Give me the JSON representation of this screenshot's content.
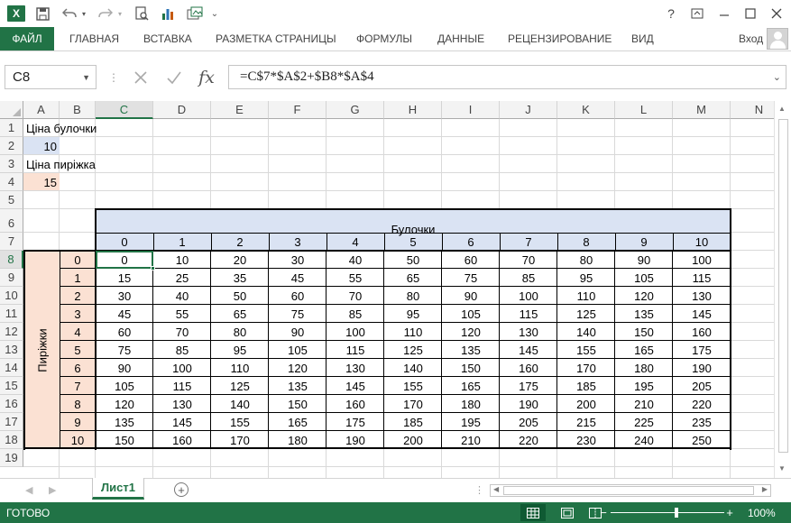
{
  "window": {
    "help_label": "?",
    "quick_access_more": "⌄"
  },
  "ribbon": {
    "file": "ФАЙЛ",
    "tabs": [
      "ГЛАВНАЯ",
      "ВСТАВКА",
      "РАЗМЕТКА СТРАНИЦЫ",
      "ФОРМУЛЫ",
      "ДАННЫЕ",
      "РЕЦЕНЗИРОВАНИЕ",
      "ВИД"
    ],
    "login": "Вход"
  },
  "formula_bar": {
    "name_box": "C8",
    "fx_label": "fx",
    "formula": "=C$7*$A$2+$B8*$A$4"
  },
  "grid": {
    "columns": [
      "A",
      "B",
      "C",
      "D",
      "E",
      "F",
      "G",
      "H",
      "I",
      "J",
      "K",
      "L",
      "M",
      "N"
    ],
    "selected_column": "C",
    "rows": [
      "1",
      "2",
      "3",
      "4",
      "5",
      "6",
      "7",
      "8",
      "9",
      "10",
      "11",
      "12",
      "13",
      "14",
      "15",
      "16",
      "17",
      "18",
      "19"
    ],
    "selected_row": "8"
  },
  "cells": {
    "A1": "Ціна булочки",
    "A2": "10",
    "A3": "Ціна пиріжка",
    "A4": "15",
    "header_top": "Булочки",
    "header_side": "Пиріжки",
    "col_values": [
      "0",
      "1",
      "2",
      "3",
      "4",
      "5",
      "6",
      "7",
      "8",
      "9",
      "10"
    ],
    "row_values": [
      "0",
      "1",
      "2",
      "3",
      "4",
      "5",
      "6",
      "7",
      "8",
      "9",
      "10"
    ],
    "table": [
      [
        "0",
        "10",
        "20",
        "30",
        "40",
        "50",
        "60",
        "70",
        "80",
        "90",
        "100"
      ],
      [
        "15",
        "25",
        "35",
        "45",
        "55",
        "65",
        "75",
        "85",
        "95",
        "105",
        "115"
      ],
      [
        "30",
        "40",
        "50",
        "60",
        "70",
        "80",
        "90",
        "100",
        "110",
        "120",
        "130"
      ],
      [
        "45",
        "55",
        "65",
        "75",
        "85",
        "95",
        "105",
        "115",
        "125",
        "135",
        "145"
      ],
      [
        "60",
        "70",
        "80",
        "90",
        "100",
        "110",
        "120",
        "130",
        "140",
        "150",
        "160"
      ],
      [
        "75",
        "85",
        "95",
        "105",
        "115",
        "125",
        "135",
        "145",
        "155",
        "165",
        "175"
      ],
      [
        "90",
        "100",
        "110",
        "120",
        "130",
        "140",
        "150",
        "160",
        "170",
        "180",
        "190"
      ],
      [
        "105",
        "115",
        "125",
        "135",
        "145",
        "155",
        "165",
        "175",
        "185",
        "195",
        "205"
      ],
      [
        "120",
        "130",
        "140",
        "150",
        "160",
        "170",
        "180",
        "190",
        "200",
        "210",
        "220"
      ],
      [
        "135",
        "145",
        "155",
        "165",
        "175",
        "185",
        "195",
        "205",
        "215",
        "225",
        "235"
      ],
      [
        "150",
        "160",
        "170",
        "180",
        "190",
        "200",
        "210",
        "220",
        "230",
        "240",
        "250"
      ]
    ]
  },
  "colors": {
    "accent": "#217346",
    "blue_fill": "#dae3f3",
    "peach_fill": "#fbe1d3"
  },
  "sheets": {
    "active": "Лист1",
    "add_label": "+"
  },
  "status": {
    "text": "ГОТОВО",
    "zoom": "100%",
    "zoom_minus": "−",
    "zoom_plus": "+"
  }
}
